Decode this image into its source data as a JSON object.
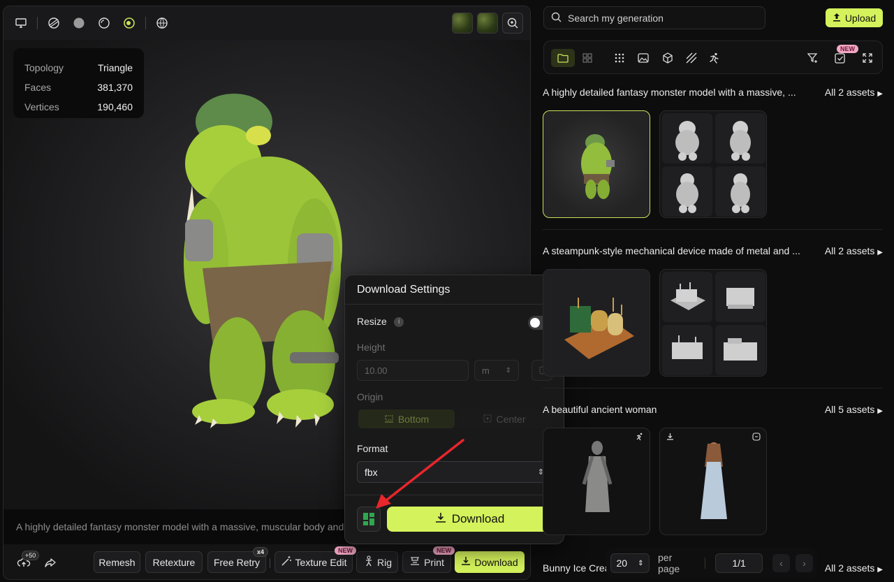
{
  "stats": {
    "topology_label": "Topology",
    "topology_value": "Triangle",
    "faces_label": "Faces",
    "faces_value": "381,370",
    "vertices_label": "Vertices",
    "vertices_value": "190,460"
  },
  "prompt": "A highly detailed fantasy monster model with a massive, muscular body and",
  "actions": {
    "credit_badge": "+50",
    "remesh": "Remesh",
    "retexture": "Retexture",
    "free_retry": "Free Retry",
    "free_retry_badge": "x4",
    "texture_edit": "Texture Edit",
    "texture_edit_badge": "NEW",
    "rig": "Rig",
    "print": "Print",
    "print_badge": "NEW",
    "download": "Download"
  },
  "download_settings": {
    "title": "Download Settings",
    "resize_label": "Resize",
    "resize_enabled": false,
    "height_label": "Height",
    "height_value": "10.00",
    "unit_value": "m",
    "origin_label": "Origin",
    "origin_bottom": "Bottom",
    "origin_center": "Center",
    "format_label": "Format",
    "format_value": "fbx",
    "download_button": "Download"
  },
  "sidebar": {
    "search_placeholder": "Search my generation",
    "upload_label": "Upload",
    "new_badge": "NEW",
    "groups": [
      {
        "title": "A highly detailed fantasy monster model with a massive, ...",
        "all": "All 2 assets"
      },
      {
        "title": "A steampunk-style mechanical device made of metal and ...",
        "all": "All 2 assets"
      },
      {
        "title": "A beautiful ancient woman",
        "all": "All 5 assets"
      },
      {
        "title": "Bunny Ice Cream",
        "all": "All 2 assets"
      }
    ]
  },
  "pager": {
    "page_size": "20",
    "per_page_label": "per page",
    "page_indicator": "1/1"
  },
  "colors": {
    "accent": "#d4f25b",
    "badge_pink": "#f2a8c3",
    "arrow_red": "#e8262b"
  }
}
